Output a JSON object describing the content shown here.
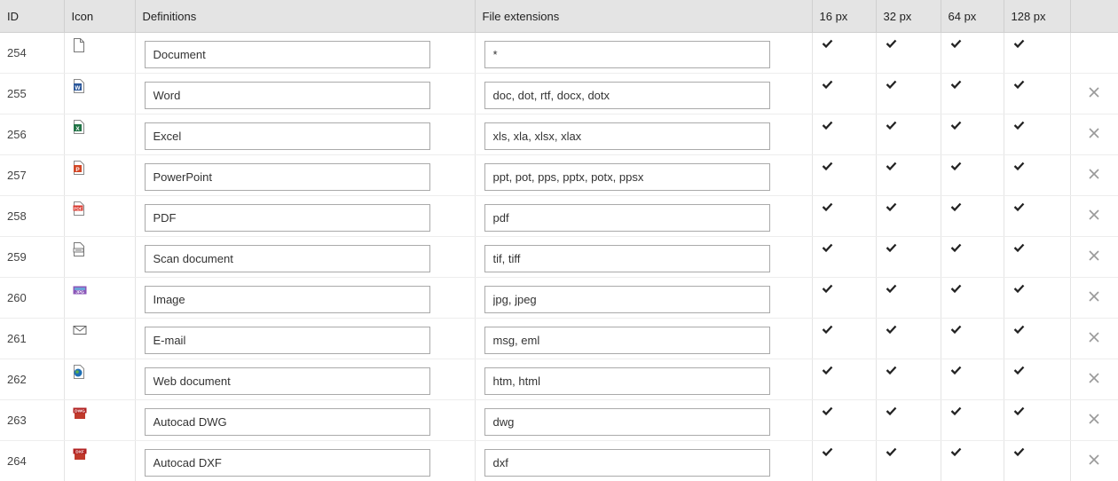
{
  "headers": {
    "id": "ID",
    "icon": "Icon",
    "definitions": "Definitions",
    "extensions": "File extensions",
    "s16": "16 px",
    "s32": "32 px",
    "s64": "64 px",
    "s128": "128 px"
  },
  "colors": {
    "word": "#2b579a",
    "excel": "#217346",
    "powerpoint": "#d24726",
    "pdf": "#d9352b",
    "image": "#8b56b8",
    "web": "#1e6fb5",
    "autocad": "#b22222"
  },
  "rows": [
    {
      "id": "254",
      "icon": "blank-document-icon",
      "definition": "Document",
      "extensions": "*",
      "deletable": false
    },
    {
      "id": "255",
      "icon": "word-document-icon",
      "definition": "Word",
      "extensions": "doc, dot, rtf, docx, dotx",
      "deletable": true
    },
    {
      "id": "256",
      "icon": "excel-document-icon",
      "definition": "Excel",
      "extensions": "xls, xla, xlsx, xlax",
      "deletable": true
    },
    {
      "id": "257",
      "icon": "powerpoint-document-icon",
      "definition": "PowerPoint",
      "extensions": "ppt, pot, pps, pptx, potx, ppsx",
      "deletable": true
    },
    {
      "id": "258",
      "icon": "pdf-document-icon",
      "definition": "PDF",
      "extensions": "pdf",
      "deletable": true
    },
    {
      "id": "259",
      "icon": "scan-document-icon",
      "definition": "Scan document",
      "extensions": "tif, tiff",
      "deletable": true
    },
    {
      "id": "260",
      "icon": "image-document-icon",
      "definition": "Image",
      "extensions": "jpg, jpeg",
      "deletable": true
    },
    {
      "id": "261",
      "icon": "email-icon",
      "definition": "E-mail",
      "extensions": "msg, eml",
      "deletable": true
    },
    {
      "id": "262",
      "icon": "web-document-icon",
      "definition": "Web document",
      "extensions": "htm, html",
      "deletable": true
    },
    {
      "id": "263",
      "icon": "autocad-dwg-icon",
      "definition": "Autocad DWG",
      "extensions": "dwg",
      "deletable": true
    },
    {
      "id": "264",
      "icon": "autocad-dxf-icon",
      "definition": "Autocad DXF",
      "extensions": "dxf",
      "deletable": true
    }
  ]
}
